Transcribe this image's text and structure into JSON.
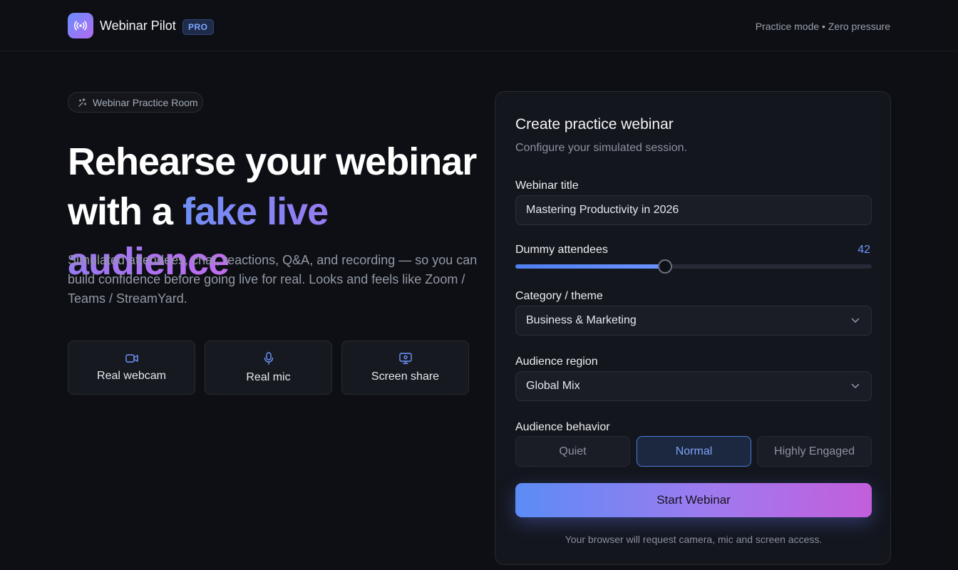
{
  "header": {
    "brand": "Webinar Pilot",
    "badge": "PRO",
    "tagline": "Practice mode • Zero pressure"
  },
  "hero": {
    "chip": "Webinar Practice Room",
    "title_line1": "Rehearse your webinar",
    "title_line2_prefix": "with a ",
    "title_line2_highlight": "fake live audience",
    "subtitle": "Simulated attendees, chat, reactions, Q&A, and recording — so you can build confidence before going live for real. Looks and feels like Zoom / Teams / StreamYard.",
    "features": [
      {
        "label": "Real webcam",
        "icon": "video-camera-icon"
      },
      {
        "label": "Real mic",
        "icon": "microphone-icon"
      },
      {
        "label": "Screen share",
        "icon": "screen-share-icon"
      }
    ]
  },
  "form": {
    "title": "Create practice webinar",
    "subtitle": "Configure your simulated session.",
    "webinar_title_label": "Webinar title",
    "webinar_title_value": "Mastering Productivity in 2026",
    "attendees_label": "Dummy attendees",
    "attendees_value": "42",
    "attendees_fraction": 0.42,
    "category_label": "Category / theme",
    "category_value": "Business & Marketing",
    "region_label": "Audience region",
    "region_value": "Global Mix",
    "behavior_label": "Audience behavior",
    "behavior_options": [
      "Quiet",
      "Normal",
      "Highly Engaged"
    ],
    "behavior_selected": "Normal",
    "start_button": "Start Webinar",
    "note": "Your browser will request camera, mic and screen access."
  },
  "colors": {
    "accent_blue": "#6b93ff",
    "gradient_start": "#5b8cf5",
    "gradient_end": "#c35edb",
    "background": "#0d0f14"
  }
}
